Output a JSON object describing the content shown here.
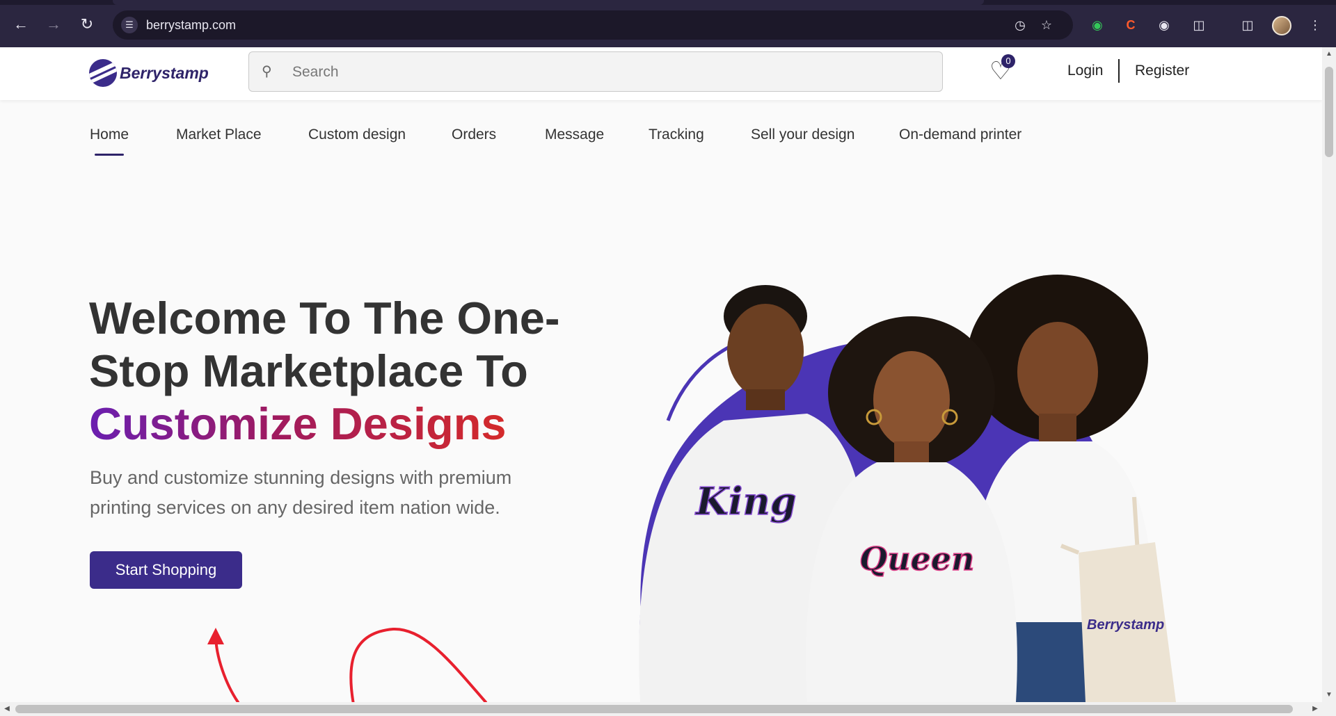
{
  "browser": {
    "url": "berrystamp.com",
    "icons": {
      "back": "arrow-left-icon",
      "forward": "arrow-right-icon",
      "reload": "reload-icon",
      "site_info": "site-info-icon",
      "performance": "gauge-icon",
      "bookmark": "star-icon"
    }
  },
  "header": {
    "brand": "Berrystamp",
    "search_placeholder": "Search",
    "wishlist_count": "0",
    "login": "Login",
    "register": "Register"
  },
  "nav": {
    "items": [
      {
        "label": "Home",
        "active": true
      },
      {
        "label": "Market Place"
      },
      {
        "label": "Custom design"
      },
      {
        "label": "Orders"
      },
      {
        "label": "Message"
      },
      {
        "label": "Tracking"
      },
      {
        "label": "Sell your design"
      },
      {
        "label": "On-demand printer"
      }
    ]
  },
  "hero": {
    "title_line1": "Welcome To The One-",
    "title_line2": "Stop Marketplace To",
    "title_highlight": "Customize Designs",
    "subtitle": "Buy and customize stunning designs with premium printing services on any desired item nation wide.",
    "cta": "Start Shopping",
    "image_labels": {
      "shirt1": "King",
      "shirt2": "Queen",
      "bag": "Berrystamp"
    }
  },
  "colors": {
    "brand": "#3b2c8a",
    "chrome": "#2b2640",
    "gradient_start": "#6a1fb0",
    "gradient_end": "#d42a2a",
    "accent_purple": "#4b35b5"
  }
}
